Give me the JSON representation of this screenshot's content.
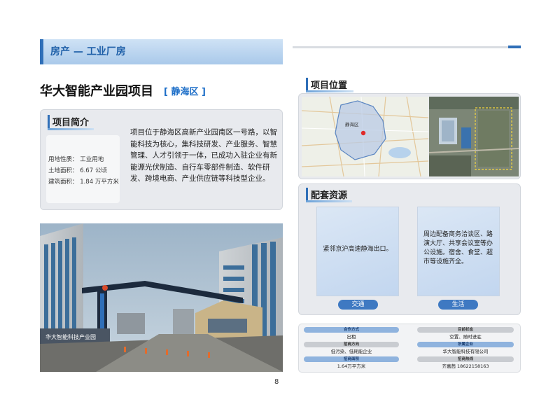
{
  "header": {
    "title": "房产 — 工业厂房"
  },
  "project": {
    "name": "华大智能产业园项目",
    "district": "[ 静海区 ]"
  },
  "intro": {
    "heading": "项目简介",
    "facts": [
      {
        "text": "用地性质：  工业用地"
      },
      {
        "text": "土地面积：  6.67 公顷"
      },
      {
        "text": "建筑面积：  1.84 万平方米"
      }
    ],
    "description": "项目位于静海区高新产业园南区一号路，以智能科技为核心，集科技研发、产业服务、智慧管理、人才引领于一体，已成功入驻企业有新能源光伏制造、自行车零部件制造、软件研发、跨境电商、产业供应链等科技型企业。"
  },
  "location": {
    "heading": "项目位置",
    "map_label": "静海区"
  },
  "photo": {
    "sign_text": "华大智能科技产业园"
  },
  "resources": {
    "heading": "配套资源",
    "items": [
      {
        "text": "紧邻京沪高速静海出口。",
        "label": "交通"
      },
      {
        "text": "周边配备商务洽谈区、路演大厅、共享会议室等办公设施。宿舍、食堂、超市等设施齐全。",
        "label": "生活"
      }
    ]
  },
  "info": {
    "rows": [
      {
        "left_label": "合作方式",
        "left_value": "出租",
        "right_label": "目前状态",
        "right_value": "空置、随时进驻"
      },
      {
        "left_label": "招商方向",
        "left_value": "低污染、低耗能企业",
        "right_label": "所属企业",
        "right_value": "华大智能科技有限公司"
      },
      {
        "left_label": "招商面积",
        "left_value": "1.64万平方米",
        "right_label": "招商热线",
        "right_value": "齐嘉茜 18622158163"
      }
    ]
  },
  "page_number": "8",
  "colors": {
    "accent": "#2f6fb8",
    "banner": "#a9c9ea",
    "card": "#e8eaee"
  }
}
